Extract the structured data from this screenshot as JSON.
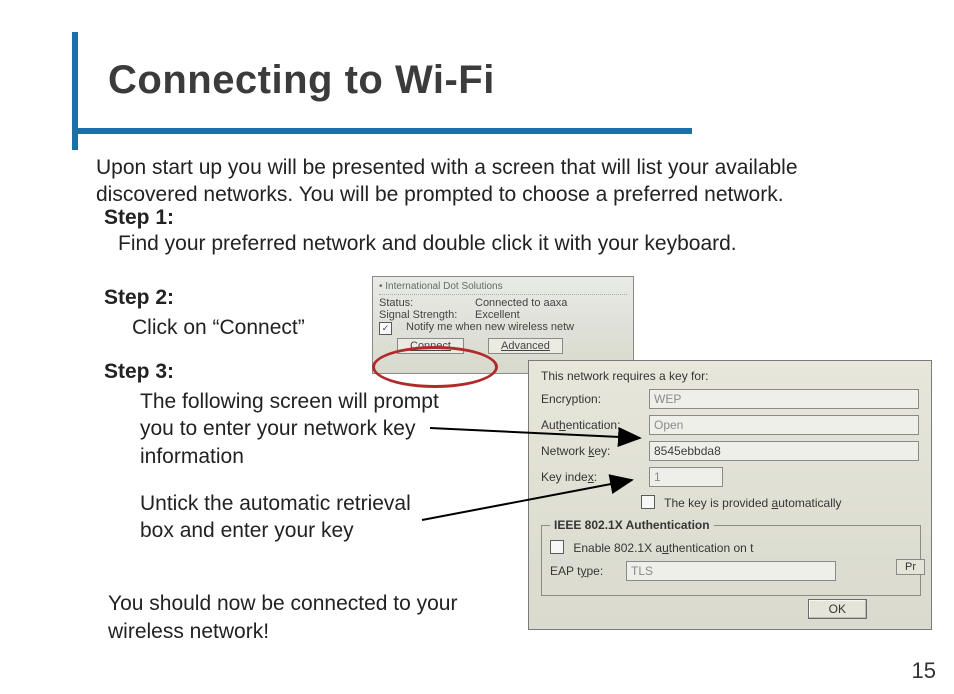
{
  "page_number": "15",
  "title": "Connecting to Wi-Fi",
  "intro": "Upon start up you will be presented with a screen that will list your available discovered networks. You will be prompted to choose a preferred network.",
  "step1": {
    "label": "Step 1:",
    "body": "Find your preferred network and double click it with your keyboard."
  },
  "step2": {
    "label": "Step 2:",
    "body": "Click on “Connect”"
  },
  "step3": {
    "label": "Step 3:",
    "body_a": "The following screen will prompt you to enter your network key information",
    "body_b": "Untick the automatic retrieval box and enter your key"
  },
  "outro": "You should now be connected to your wireless network!",
  "shot1": {
    "header_item": "International Dot Solutions",
    "status_label": "Status:",
    "status_value": "Connected to aaxa",
    "signal_label": "Signal Strength:",
    "signal_value": "Excellent",
    "notify": "Notify me when new wireless netw",
    "connect": "Connect",
    "advanced": "Advanced"
  },
  "shot2": {
    "intro": "This network requires a key for:",
    "encryption_label": "Encryption:",
    "encryption_value": "WEP",
    "auth_label": "Authentication:",
    "auth_value": "Open",
    "key_label": "Network key:",
    "key_value": "8545ebbda8",
    "index_label": "Key index:",
    "index_value": "1",
    "auto_label": "The key is provided automatically",
    "group_label": "IEEE 802.1X Authentication",
    "enable_label": "Enable 802.1X authentication on t",
    "eap_label": "EAP type:",
    "eap_value": "TLS",
    "pr": "Pr",
    "ok": "OK"
  }
}
